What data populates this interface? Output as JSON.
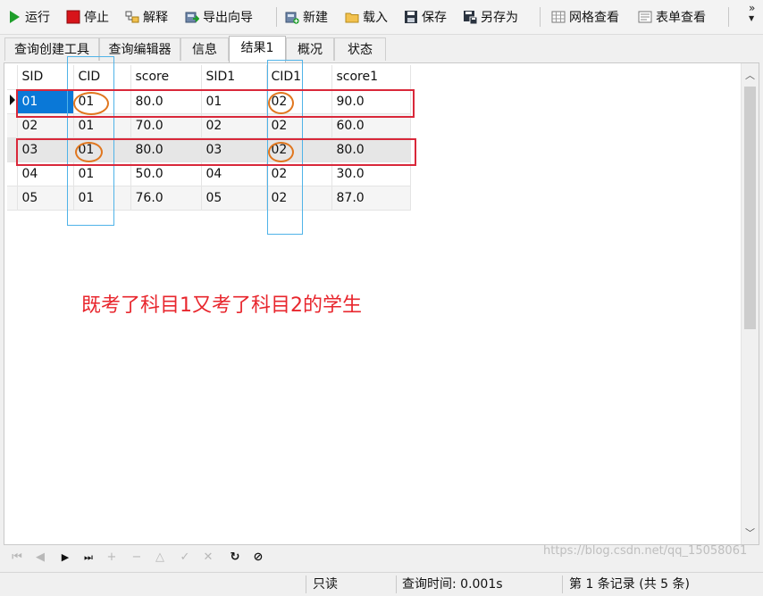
{
  "toolbar": {
    "run": "运行",
    "stop": "停止",
    "explain": "解释",
    "export_wizard": "导出向导",
    "new": "新建",
    "load": "载入",
    "save": "保存",
    "save_as": "另存为",
    "grid_view": "网格查看",
    "form_view": "表单查看",
    "more": "»"
  },
  "tabs": [
    "查询创建工具",
    "查询编辑器",
    "信息",
    "结果1",
    "概况",
    "状态"
  ],
  "active_tab": "结果1",
  "grid": {
    "columns": [
      "SID",
      "CID",
      "score",
      "SID1",
      "CID1",
      "score1"
    ],
    "rows": [
      [
        "01",
        "01",
        "80.0",
        "01",
        "02",
        "90.0"
      ],
      [
        "02",
        "01",
        "70.0",
        "02",
        "02",
        "60.0"
      ],
      [
        "03",
        "01",
        "80.0",
        "03",
        "02",
        "80.0"
      ],
      [
        "04",
        "01",
        "50.0",
        "04",
        "02",
        "30.0"
      ],
      [
        "05",
        "01",
        "76.0",
        "05",
        "02",
        "87.0"
      ]
    ],
    "selected_cell": "01"
  },
  "annotation": {
    "note": "既考了科目1又考了科目2的学生",
    "highlight_color": "#d9283a",
    "circle_color": "#e0761e",
    "column_box_color": "#4fb3e8"
  },
  "status": {
    "readonly": "只读",
    "query_time": "查询时间: 0.001s",
    "record_info": "第 1 条记录 (共 5 条)"
  },
  "watermark": "https://blog.csdn.net/qq_15058061"
}
